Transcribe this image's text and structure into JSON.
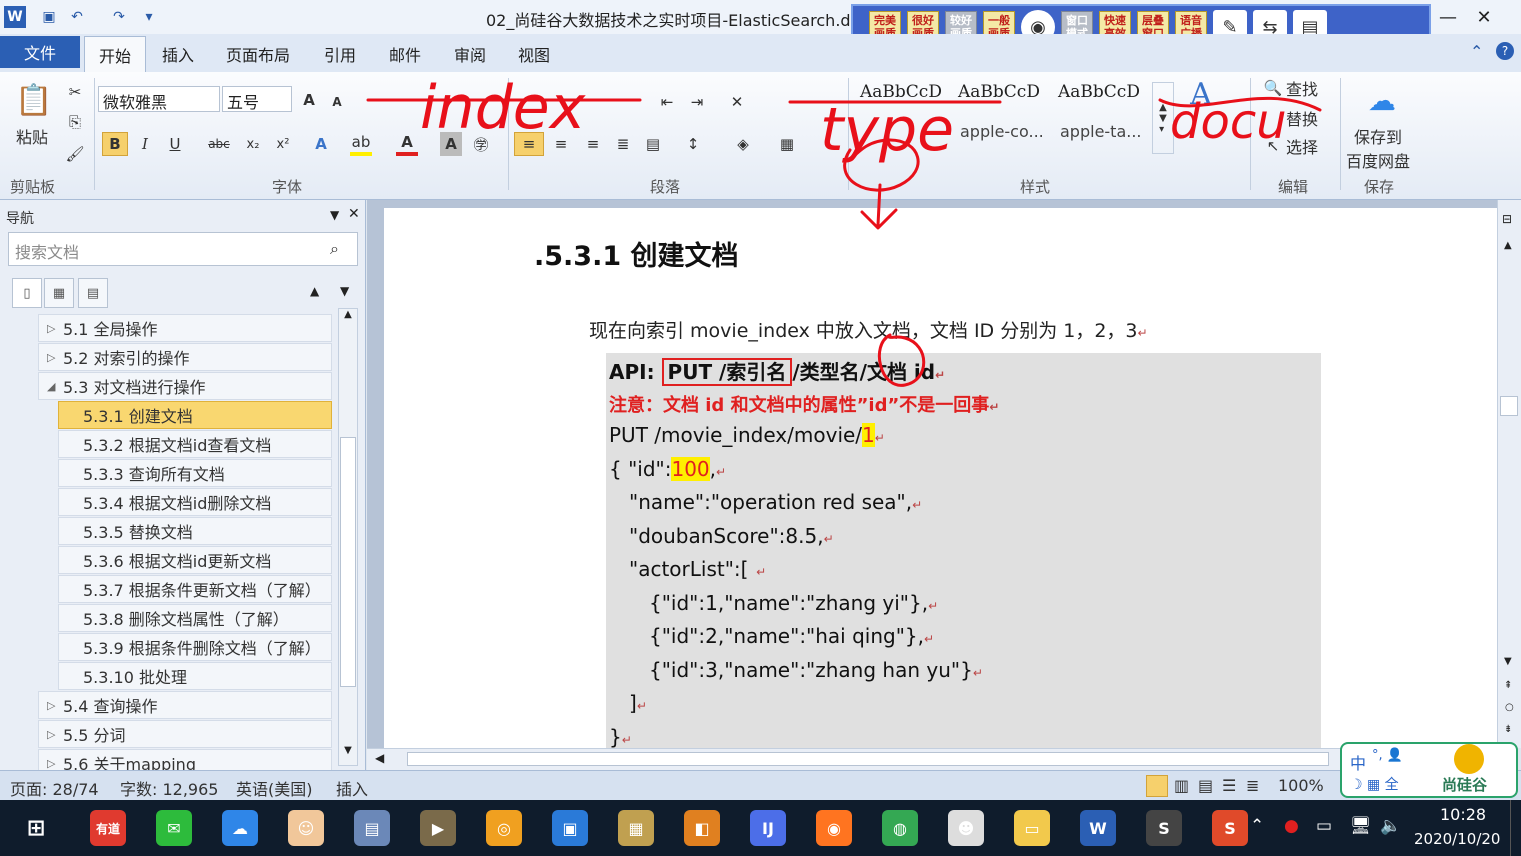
{
  "window": {
    "title": "02_尚硅谷大数据技术之实时项目-ElasticSearch.d",
    "min": "—",
    "max": "□",
    "close": "✕"
  },
  "player_toolbar": {
    "buttons": [
      "完美画质",
      "很好画质",
      "较好画质",
      "一般画质",
      "窗口模式",
      "快速高效",
      "层叠窗口",
      "语音广播"
    ]
  },
  "ribbon": {
    "tabs": [
      "文件",
      "开始",
      "插入",
      "页面布局",
      "引用",
      "邮件",
      "审阅",
      "视图"
    ],
    "paste_label": "粘贴",
    "font_name": "微软雅黑",
    "font_size": "五号",
    "groups": [
      "剪贴板",
      "字体",
      "段落",
      "样式",
      "编辑",
      "保存"
    ],
    "styles": [
      {
        "sample": "AaBbCcD",
        "name": ""
      },
      {
        "sample": "AaBbCcD",
        "name": "apple-co..."
      },
      {
        "sample": "AaBbCcD",
        "name": "apple-ta..."
      }
    ],
    "find": "查找",
    "replace": "替换",
    "select": "选择",
    "save_to": "保存到",
    "baidu": "百度网盘"
  },
  "navigation": {
    "title": "导航",
    "search_placeholder": "搜索文档",
    "items": [
      {
        "label": "5.1 全局操作",
        "level": 1
      },
      {
        "label": "5.2 对索引的操作",
        "level": 1
      },
      {
        "label": "5.3 对文档进行操作",
        "level": 1
      },
      {
        "label": "5.3.1 创建文档",
        "level": 2
      },
      {
        "label": "5.3.2 根据文档id查看文档",
        "level": 2
      },
      {
        "label": "5.3.3 查询所有文档",
        "level": 2
      },
      {
        "label": "5.3.4 根据文档id删除文档",
        "level": 2
      },
      {
        "label": "5.3.5 替换文档",
        "level": 2
      },
      {
        "label": "5.3.6 根据文档id更新文档",
        "level": 2
      },
      {
        "label": "5.3.7 根据条件更新文档（了解）",
        "level": 2
      },
      {
        "label": "5.3.8 删除文档属性（了解）",
        "level": 2
      },
      {
        "label": "5.3.9 根据条件删除文档（了解）",
        "level": 2
      },
      {
        "label": "5.3.10 批处理",
        "level": 2
      },
      {
        "label": "5.4 查询操作",
        "level": 1
      },
      {
        "label": "5.5 分词",
        "level": 1
      },
      {
        "label": "5.6 关于mapping",
        "level": 1
      }
    ]
  },
  "document": {
    "heading": ".5.3.1 创建文档",
    "intro": "现在向索引 movie_index 中放入文档，文档 ID 分别为 1，2，3",
    "api_label": "API:",
    "api_put": "PUT /索引名",
    "api_rest": "/类型名/文档 id",
    "note": "注意：文档 id 和文档中的属性”id”不是一回事",
    "put_line": "PUT /movie_index/movie/",
    "put_id": "1",
    "id_open": "{ \"id\":",
    "id_val": "100",
    "id_comma": ",",
    "lines": [
      "\"name\":\"operation red sea\",",
      "\"doubanScore\":8.5,",
      "\"actorList\":[",
      "{\"id\":1,\"name\":\"zhang yi\"},",
      "{\"id\":2,\"name\":\"hai qing\"},",
      "{\"id\":3,\"name\":\"zhang han yu\"}",
      "]",
      "}"
    ]
  },
  "annotations": [
    "index",
    "type",
    "docu"
  ],
  "status": {
    "page": "页面: 28/74",
    "words": "字数: 12,965",
    "lang": "英语(美国)",
    "mode": "插入",
    "zoom": "100%"
  },
  "ime": {
    "text": "中",
    "brand": "尚硅谷"
  },
  "taskbar": {
    "apps": [
      "有道",
      "微信",
      "百度网盘",
      "QQ",
      "阅读器",
      "电影",
      "Chrome Canary",
      "画图",
      "显示",
      "截图",
      "IntelliJ",
      "Firefox",
      "Chrome",
      "表情",
      "文件夹",
      "Word",
      "终端",
      "WPS"
    ],
    "time": "10:28",
    "date": "2020/10/20"
  }
}
